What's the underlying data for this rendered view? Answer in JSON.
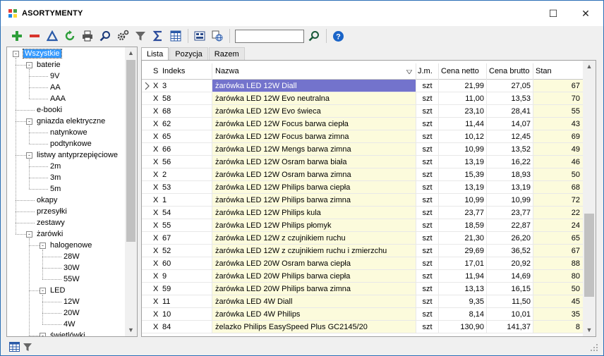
{
  "window": {
    "title": "ASORTYMENTY",
    "minimize_glyph": "☐",
    "close_glyph": "✕"
  },
  "toolbar": {
    "icons": [
      "add-icon",
      "delete-icon",
      "delta-icon",
      "refresh-icon",
      "print-icon",
      "search-icon",
      "settings-icon",
      "filter-icon",
      "sum-icon",
      "columns-icon",
      "barcode-icon",
      "globe-icon",
      "find-icon",
      "help-icon"
    ],
    "search_value": ""
  },
  "tree": {
    "items": [
      {
        "label": "Wszystkie",
        "level": 0,
        "expander": "-",
        "selected": true
      },
      {
        "label": "baterie",
        "level": 1,
        "expander": "-"
      },
      {
        "label": "9V",
        "level": 2
      },
      {
        "label": "AA",
        "level": 2
      },
      {
        "label": "AAA",
        "level": 2
      },
      {
        "label": "e-booki",
        "level": 1
      },
      {
        "label": "gniazda elektryczne",
        "level": 1,
        "expander": "-"
      },
      {
        "label": "natynkowe",
        "level": 2
      },
      {
        "label": "podtynkowe",
        "level": 2
      },
      {
        "label": "listwy antyprzepięciowe",
        "level": 1,
        "expander": "-"
      },
      {
        "label": "2m",
        "level": 2
      },
      {
        "label": "3m",
        "level": 2
      },
      {
        "label": "5m",
        "level": 2
      },
      {
        "label": "okapy",
        "level": 1
      },
      {
        "label": "przesyłki",
        "level": 1
      },
      {
        "label": "zestawy",
        "level": 1
      },
      {
        "label": "żarówki",
        "level": 1,
        "expander": "-"
      },
      {
        "label": "halogenowe",
        "level": 2,
        "expander": "-"
      },
      {
        "label": "28W",
        "level": 3
      },
      {
        "label": "30W",
        "level": 3
      },
      {
        "label": "55W",
        "level": 3
      },
      {
        "label": "LED",
        "level": 2,
        "expander": "-"
      },
      {
        "label": "12W",
        "level": 3
      },
      {
        "label": "20W",
        "level": 3
      },
      {
        "label": "4W",
        "level": 3
      },
      {
        "label": "świetlówki",
        "level": 2,
        "expander": "-"
      }
    ]
  },
  "tabs": [
    {
      "label": "Lista",
      "active": true
    },
    {
      "label": "Pozycja",
      "active": false
    },
    {
      "label": "Razem",
      "active": false
    }
  ],
  "grid": {
    "columns": {
      "s": "S",
      "indeks": "Indeks",
      "nazwa": "Nazwa",
      "jm": "J.m.",
      "netto": "Cena netto",
      "brutto": "Cena brutto",
      "stan": "Stan"
    },
    "rows": [
      {
        "s": "X",
        "indeks": "3",
        "nazwa": "żarówka LED 12W Diall",
        "jm": "szt",
        "netto": "21,99",
        "brutto": "27,05",
        "stan": "67",
        "selected": true
      },
      {
        "s": "X",
        "indeks": "58",
        "nazwa": "żarówka LED 12W Evo neutralna",
        "jm": "szt",
        "netto": "11,00",
        "brutto": "13,53",
        "stan": "70"
      },
      {
        "s": "X",
        "indeks": "68",
        "nazwa": "żarówka LED 12W Evo świeca",
        "jm": "szt",
        "netto": "23,10",
        "brutto": "28,41",
        "stan": "55"
      },
      {
        "s": "X",
        "indeks": "62",
        "nazwa": "żarówka LED 12W Focus barwa ciepła",
        "jm": "szt",
        "netto": "11,44",
        "brutto": "14,07",
        "stan": "43"
      },
      {
        "s": "X",
        "indeks": "65",
        "nazwa": "żarówka LED 12W Focus barwa zimna",
        "jm": "szt",
        "netto": "10,12",
        "brutto": "12,45",
        "stan": "69"
      },
      {
        "s": "X",
        "indeks": "66",
        "nazwa": "żarówka LED 12W Mengs barwa zimna",
        "jm": "szt",
        "netto": "10,99",
        "brutto": "13,52",
        "stan": "49"
      },
      {
        "s": "X",
        "indeks": "56",
        "nazwa": "żarówka LED 12W Osram barwa biała",
        "jm": "szt",
        "netto": "13,19",
        "brutto": "16,22",
        "stan": "46"
      },
      {
        "s": "X",
        "indeks": "2",
        "nazwa": "żarówka LED 12W Osram barwa zimna",
        "jm": "szt",
        "netto": "15,39",
        "brutto": "18,93",
        "stan": "50"
      },
      {
        "s": "X",
        "indeks": "53",
        "nazwa": "żarówka LED 12W Philips barwa ciepła",
        "jm": "szt",
        "netto": "13,19",
        "brutto": "13,19",
        "stan": "68"
      },
      {
        "s": "X",
        "indeks": "1",
        "nazwa": "żarówka LED 12W Philips barwa zimna",
        "jm": "szt",
        "netto": "10,99",
        "brutto": "10,99",
        "stan": "72"
      },
      {
        "s": "X",
        "indeks": "54",
        "nazwa": "żarówka LED 12W Philips kula",
        "jm": "szt",
        "netto": "23,77",
        "brutto": "23,77",
        "stan": "22"
      },
      {
        "s": "X",
        "indeks": "55",
        "nazwa": "żarówka LED 12W Philips płomyk",
        "jm": "szt",
        "netto": "18,59",
        "brutto": "22,87",
        "stan": "24"
      },
      {
        "s": "X",
        "indeks": "67",
        "nazwa": "żarówka LED 12W z czujnikiem ruchu",
        "jm": "szt",
        "netto": "21,30",
        "brutto": "26,20",
        "stan": "65"
      },
      {
        "s": "X",
        "indeks": "52",
        "nazwa": "żarówka LED 12W z czujnikiem ruchu i zmierzchu",
        "jm": "szt",
        "netto": "29,69",
        "brutto": "36,52",
        "stan": "67"
      },
      {
        "s": "X",
        "indeks": "60",
        "nazwa": "żarówka LED 20W Osram barwa ciepła",
        "jm": "szt",
        "netto": "17,01",
        "brutto": "20,92",
        "stan": "88"
      },
      {
        "s": "X",
        "indeks": "9",
        "nazwa": "żarówka LED 20W Philips barwa ciepła",
        "jm": "szt",
        "netto": "11,94",
        "brutto": "14,69",
        "stan": "80"
      },
      {
        "s": "X",
        "indeks": "59",
        "nazwa": "żarówka LED 20W Philips barwa zimna",
        "jm": "szt",
        "netto": "13,13",
        "brutto": "16,15",
        "stan": "50"
      },
      {
        "s": "X",
        "indeks": "11",
        "nazwa": "żarówka LED 4W Diall",
        "jm": "szt",
        "netto": "9,35",
        "brutto": "11,50",
        "stan": "45"
      },
      {
        "s": "X",
        "indeks": "10",
        "nazwa": "żarówka LED 4W Philips",
        "jm": "szt",
        "netto": "8,14",
        "brutto": "10,01",
        "stan": "35"
      },
      {
        "s": "X",
        "indeks": "84",
        "nazwa": "żelazko Philips EasySpeed Plus GC2145/20",
        "jm": "szt",
        "netto": "130,90",
        "brutto": "141,37",
        "stan": "8"
      }
    ]
  },
  "colors": {
    "accent": "#3399ff",
    "selected_row": "#7373cc",
    "highlight_column": "#fcfbdc"
  }
}
